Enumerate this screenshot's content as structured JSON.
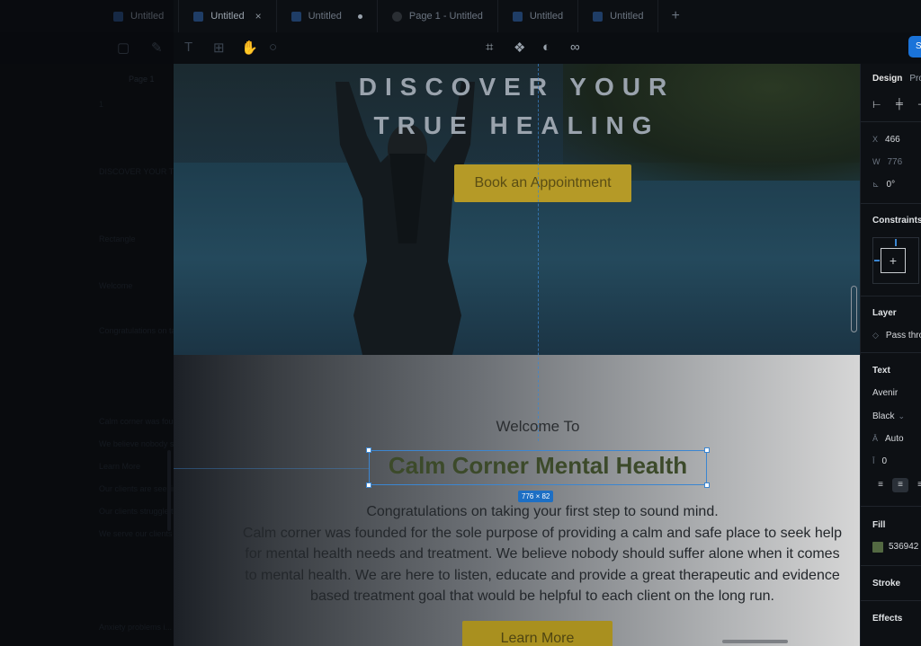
{
  "tabs": [
    {
      "label": "Untitled",
      "state": "faded"
    },
    {
      "label": "Untitled",
      "state": "active-close",
      "close": "×"
    },
    {
      "label": "Untitled",
      "state": "unsaved"
    },
    {
      "label": "Page 1 - Untitled",
      "state": "normal"
    },
    {
      "label": "Untitled",
      "state": "normal"
    },
    {
      "label": "Untitled",
      "state": "normal"
    }
  ],
  "tab_add": "+",
  "toolbar": {
    "tools_left": [
      "frame-icon",
      "pen-icon",
      "text-icon",
      "resources-icon",
      "hand-icon",
      "comment-icon"
    ],
    "text_tool": "T",
    "tools_mid": [
      "crop-icon",
      "component-icon",
      "contrast-icon",
      "link-icon"
    ],
    "share_label": "S"
  },
  "left_panel": {
    "page_label": "Page 1",
    "layers": [
      "1",
      "DISCOVER YOUR TRUE HEAL...",
      "Rectangle",
      "Welcome",
      "Congratulations on taking yo...",
      "",
      "Calm corner was founded for...",
      "We believe nobody should s...",
      "Learn More",
      "Our clients are seeking...",
      "Our clients struggle to addr...",
      "We serve our clients as...",
      "Anxiety problems i..."
    ]
  },
  "canvas": {
    "hero_line1": "DISCOVER YOUR",
    "hero_line2": "TRUE HEALING",
    "hero_button": "Book an Appointment",
    "welcome": "Welcome To",
    "heading": "Calm Corner Mental Health",
    "dimension_badge": "776 × 82",
    "body_lines": [
      "Congratulations on taking your first step to sound mind.",
      "Calm corner was founded for the sole purpose of providing a calm and safe place to seek help",
      "for mental health needs and treatment. We believe nobody should suffer alone when it comes",
      "to mental health. We are here to listen, educate and provide a great therapeutic and evidence",
      "based treatment goal that would be helpful to each client on the long run."
    ],
    "learn_more": "Learn More"
  },
  "right_panel": {
    "tab_design": "Design",
    "tab_prototype": "Pro",
    "x_label": "X",
    "x_value": "466",
    "w_label": "W",
    "w_value": "776",
    "rotation_value": "0°",
    "constraints": "Constraints",
    "layer": "Layer",
    "blend": "Pass thro",
    "text": "Text",
    "font_family": "Avenir",
    "font_weight": "Black",
    "line_height": "Auto",
    "letter_spacing": "0",
    "fill": "Fill",
    "fill_hex": "536942",
    "stroke": "Stroke",
    "effects": "Effects"
  },
  "colors": {
    "accent_blue": "#3b86d1",
    "heading_green": "#536942",
    "button_gold": "#b59a27"
  }
}
